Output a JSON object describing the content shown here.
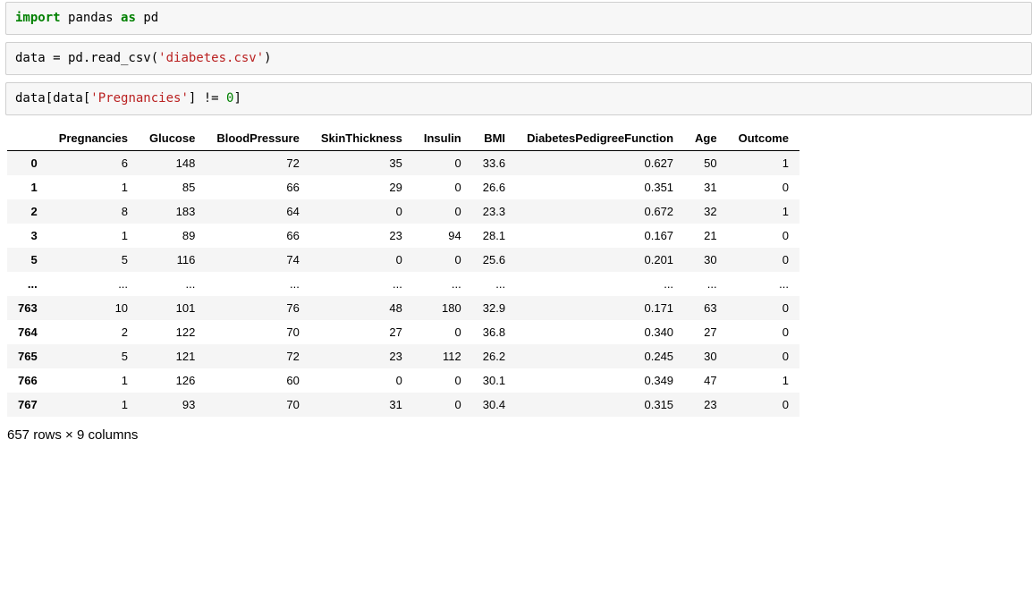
{
  "cells": {
    "c1": {
      "kw_import": "import",
      "mod": "pandas",
      "kw_as": "as",
      "alias": "pd"
    },
    "c2": {
      "lhs": "data = pd.read_csv(",
      "arg": "'diabetes.csv'",
      "rhs": ")"
    },
    "c3": {
      "p1": "data[data[",
      "col": "'Pregnancies'",
      "p2": "] != ",
      "num": "0",
      "p3": "]"
    }
  },
  "table": {
    "columns": [
      "Pregnancies",
      "Glucose",
      "BloodPressure",
      "SkinThickness",
      "Insulin",
      "BMI",
      "DiabetesPedigreeFunction",
      "Age",
      "Outcome"
    ],
    "rows": [
      {
        "idx": "0",
        "vals": [
          "6",
          "148",
          "72",
          "35",
          "0",
          "33.6",
          "0.627",
          "50",
          "1"
        ]
      },
      {
        "idx": "1",
        "vals": [
          "1",
          "85",
          "66",
          "29",
          "0",
          "26.6",
          "0.351",
          "31",
          "0"
        ]
      },
      {
        "idx": "2",
        "vals": [
          "8",
          "183",
          "64",
          "0",
          "0",
          "23.3",
          "0.672",
          "32",
          "1"
        ]
      },
      {
        "idx": "3",
        "vals": [
          "1",
          "89",
          "66",
          "23",
          "94",
          "28.1",
          "0.167",
          "21",
          "0"
        ]
      },
      {
        "idx": "5",
        "vals": [
          "5",
          "116",
          "74",
          "0",
          "0",
          "25.6",
          "0.201",
          "30",
          "0"
        ]
      },
      {
        "idx": "...",
        "vals": [
          "...",
          "...",
          "...",
          "...",
          "...",
          "...",
          "...",
          "...",
          "..."
        ]
      },
      {
        "idx": "763",
        "vals": [
          "10",
          "101",
          "76",
          "48",
          "180",
          "32.9",
          "0.171",
          "63",
          "0"
        ]
      },
      {
        "idx": "764",
        "vals": [
          "2",
          "122",
          "70",
          "27",
          "0",
          "36.8",
          "0.340",
          "27",
          "0"
        ]
      },
      {
        "idx": "765",
        "vals": [
          "5",
          "121",
          "72",
          "23",
          "112",
          "26.2",
          "0.245",
          "30",
          "0"
        ]
      },
      {
        "idx": "766",
        "vals": [
          "1",
          "126",
          "60",
          "0",
          "0",
          "30.1",
          "0.349",
          "47",
          "1"
        ]
      },
      {
        "idx": "767",
        "vals": [
          "1",
          "93",
          "70",
          "31",
          "0",
          "30.4",
          "0.315",
          "23",
          "0"
        ]
      }
    ]
  },
  "summary": "657 rows × 9 columns"
}
